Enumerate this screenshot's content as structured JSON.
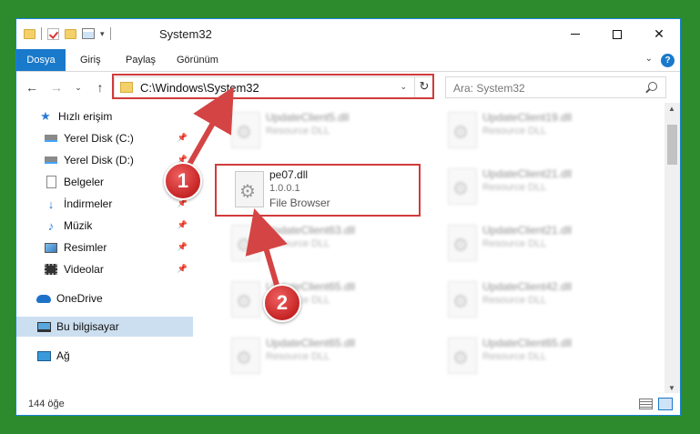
{
  "window": {
    "title": "System32",
    "controls": {
      "minimize": "—",
      "maximize": "☐",
      "close": "✕"
    }
  },
  "ribbon": {
    "tabs": [
      "Dosya",
      "Giriş",
      "Paylaş",
      "Görünüm"
    ],
    "help": "?"
  },
  "nav": {
    "back": "←",
    "forward": "→",
    "recent": "⌄",
    "up": "↑",
    "address": "C:\\Windows\\System32",
    "refresh": "↻",
    "search_placeholder": "Ara: System32"
  },
  "sidebar": {
    "items": [
      {
        "label": "Hızlı erişim",
        "icon": "star-icon"
      },
      {
        "label": "Yerel Disk (C:)",
        "icon": "disk-icon",
        "pinned": true
      },
      {
        "label": "Yerel Disk (D:)",
        "icon": "disk-icon",
        "pinned": true
      },
      {
        "label": "Belgeler",
        "icon": "document-icon",
        "pinned": true
      },
      {
        "label": "İndirmeler",
        "icon": "download-icon",
        "pinned": true
      },
      {
        "label": "Müzik",
        "icon": "music-icon",
        "pinned": true
      },
      {
        "label": "Resimler",
        "icon": "picture-icon",
        "pinned": true
      },
      {
        "label": "Videolar",
        "icon": "video-icon",
        "pinned": true
      },
      {
        "label": "OneDrive",
        "icon": "cloud-icon"
      },
      {
        "label": "Bu bilgisayar",
        "icon": "computer-icon",
        "selected": true
      },
      {
        "label": "Ağ",
        "icon": "network-icon"
      }
    ],
    "pin_glyph": "📌"
  },
  "files": {
    "left_column": [
      {
        "name": "UpdateClient5.dll",
        "type": "Resource DLL"
      },
      {
        "name": "UpdateClient63.dll",
        "type": "Resource DLL"
      },
      {
        "name": "UpdateClient65.dll",
        "type": "Resource DLL"
      },
      {
        "name": "UpdateClient65.dll",
        "type": "Resource DLL"
      }
    ],
    "right_column": [
      {
        "name": "UpdateClient19.dll",
        "type": "Resource DLL"
      },
      {
        "name": "UpdateClient21.dll",
        "type": "Resource DLL"
      },
      {
        "name": "UpdateClient21.dll",
        "type": "Resource DLL"
      },
      {
        "name": "UpdateClient42.dll",
        "type": "Resource DLL"
      },
      {
        "name": "UpdateClient65.dll",
        "type": "Resource DLL"
      }
    ],
    "highlighted": {
      "name": "pe07.dll",
      "version": "1.0.0.1",
      "type": "File Browser"
    }
  },
  "status": {
    "count": "144 öğe"
  },
  "annotations": {
    "step1": "1",
    "step2": "2"
  },
  "colors": {
    "highlight": "#d13b3b",
    "accent": "#1979ca",
    "desktop": "#2d8a2d"
  }
}
